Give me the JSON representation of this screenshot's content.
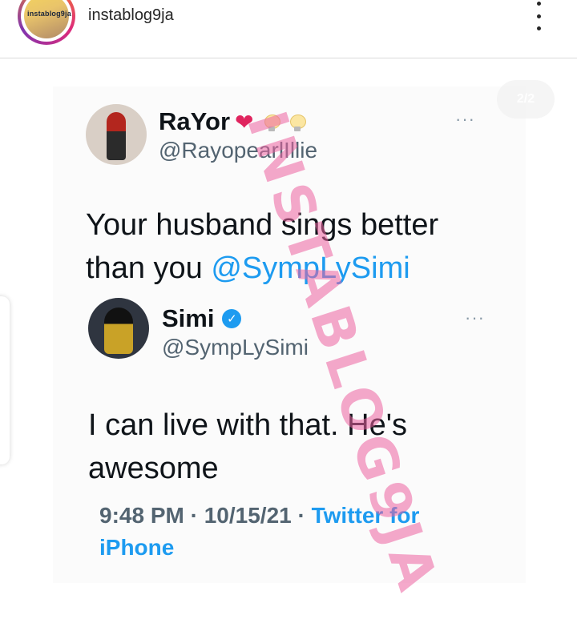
{
  "header": {
    "username": "instablog9ja",
    "avatar_text": "instablog9ja",
    "more_icon": "more-vertical-icon"
  },
  "post": {
    "page_counter": "2/2",
    "watermark": "INSTABLOG9JA",
    "tweet": {
      "author_name": "RaYor",
      "author_emojis": [
        "red-heart",
        "light-bulb",
        "light-bulb"
      ],
      "author_handle": "@RayopearlIllie",
      "text": "Your husband sings better than you ",
      "mention": "@SympLySimi",
      "more_icon": "ellipsis-icon"
    },
    "reply": {
      "author_name": "Simi",
      "verified": true,
      "author_handle": "@SympLySimi",
      "text": "I can live with that. He's awesome",
      "time": "9:48 PM",
      "date": "10/15/21",
      "separator": "·",
      "source": "Twitter for iPhone",
      "more_icon": "ellipsis-icon"
    }
  },
  "colors": {
    "link_blue": "#1d9bf0",
    "secondary_text": "#536471",
    "watermark_pink": "#ec62a0"
  }
}
